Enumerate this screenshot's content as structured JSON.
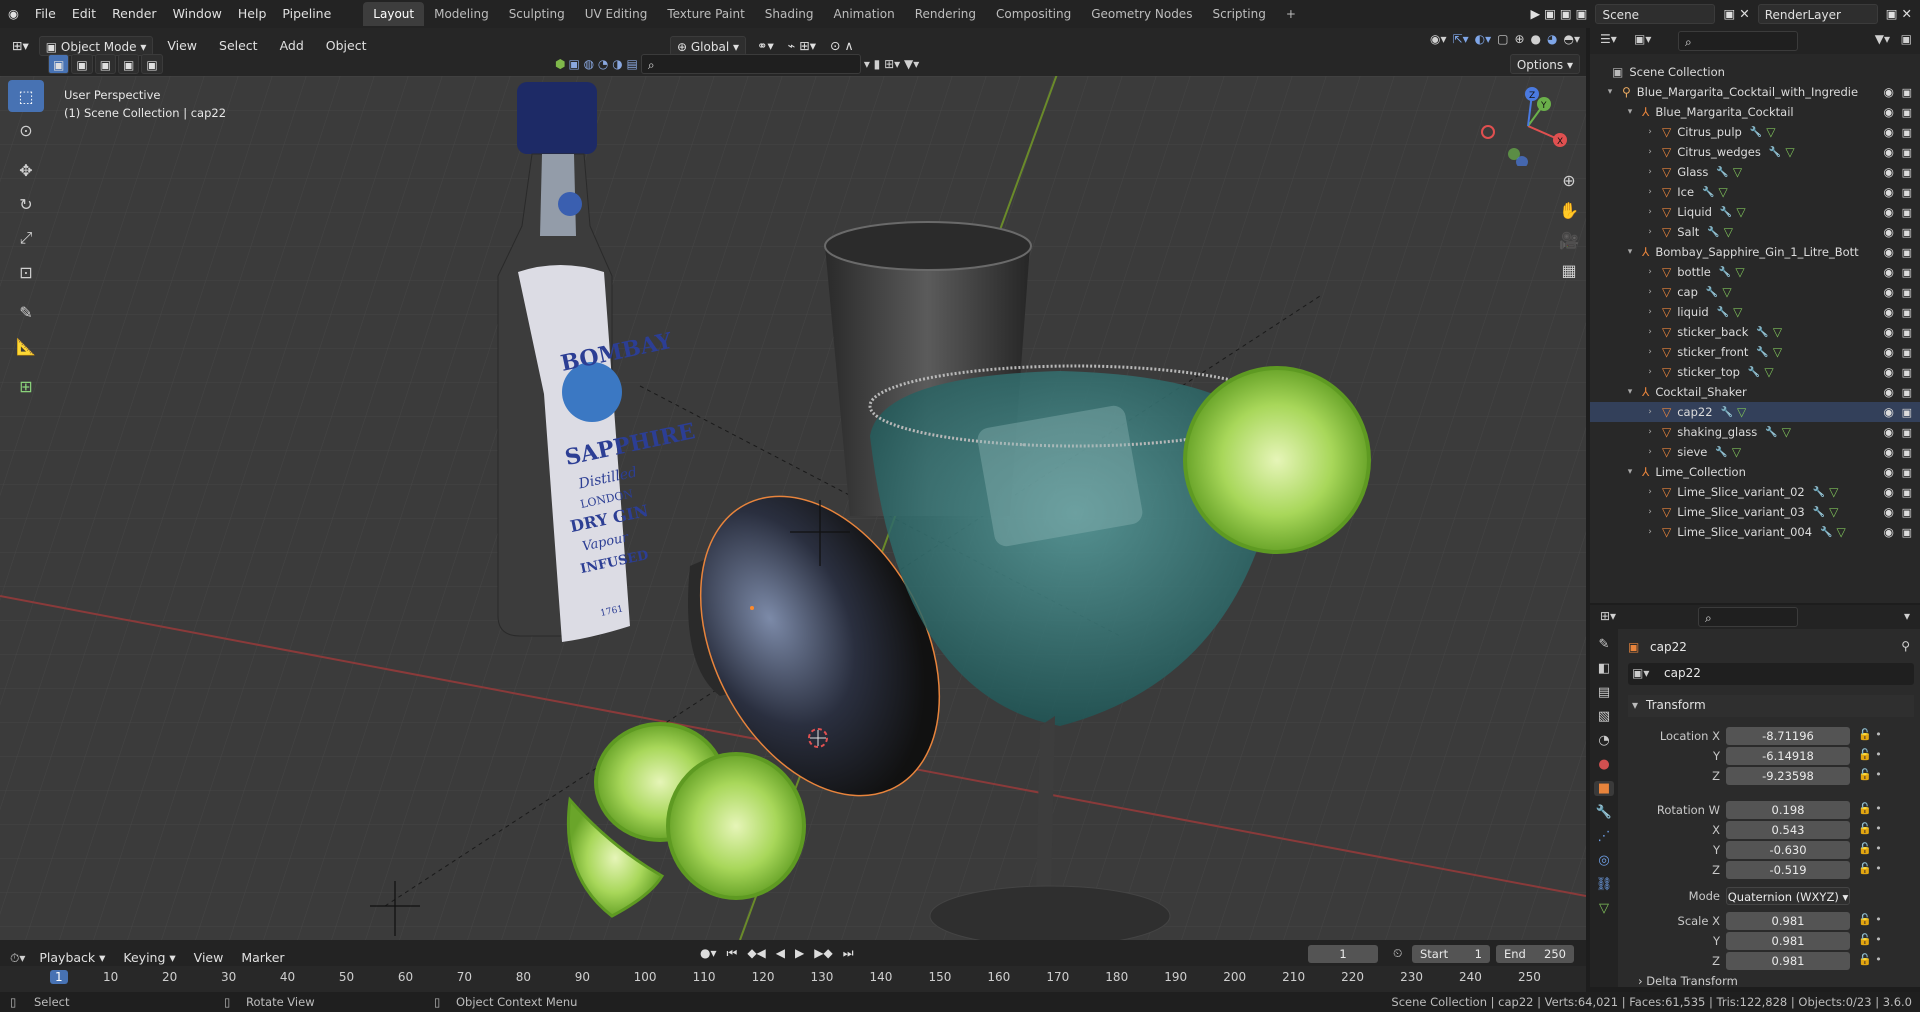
{
  "topbar": {
    "menus": [
      "File",
      "Edit",
      "Render",
      "Window",
      "Help",
      "Pipeline"
    ],
    "workspaces": [
      "Layout",
      "Modeling",
      "Sculpting",
      "UV Editing",
      "Texture Paint",
      "Shading",
      "Animation",
      "Rendering",
      "Compositing",
      "Geometry Nodes",
      "Scripting"
    ],
    "active_workspace": "Layout",
    "scene": "Scene",
    "view_layer": "RenderLayer"
  },
  "viewport_header": {
    "mode": "Object Mode",
    "menus": [
      "View",
      "Select",
      "Add",
      "Object"
    ],
    "orientation": "Global",
    "options": "Options"
  },
  "viewport": {
    "perspective": "User Perspective",
    "collection_info": "(1) Scene Collection | cap22",
    "gizmo": {
      "x": "X",
      "y": "Y",
      "z": "Z"
    },
    "label": {
      "brand1": "BOMBAY",
      "brand2": "SAPPHIRE",
      "line1": "Distilled",
      "line2": "LONDON",
      "line3": "DRY GIN",
      "line4": "Vapour",
      "line5": "INFUSED",
      "year": "1761"
    }
  },
  "outliner": {
    "root": "Scene Collection",
    "rows": [
      {
        "level": 1,
        "type": "collection",
        "name": "Blue_Margarita_Cocktail_with_Ingredie",
        "expanded": true
      },
      {
        "level": 2,
        "type": "empty",
        "name": "Blue_Margarita_Cocktail",
        "expanded": true
      },
      {
        "level": 3,
        "type": "mesh",
        "name": "Citrus_pulp"
      },
      {
        "level": 3,
        "type": "mesh",
        "name": "Citrus_wedges"
      },
      {
        "level": 3,
        "type": "mesh",
        "name": "Glass"
      },
      {
        "level": 3,
        "type": "mesh",
        "name": "Ice"
      },
      {
        "level": 3,
        "type": "mesh",
        "name": "Liquid"
      },
      {
        "level": 3,
        "type": "mesh",
        "name": "Salt"
      },
      {
        "level": 2,
        "type": "empty",
        "name": "Bombay_Sapphire_Gin_1_Litre_Bott",
        "expanded": true
      },
      {
        "level": 3,
        "type": "mesh",
        "name": "bottle"
      },
      {
        "level": 3,
        "type": "mesh",
        "name": "cap"
      },
      {
        "level": 3,
        "type": "mesh",
        "name": "liquid"
      },
      {
        "level": 3,
        "type": "mesh",
        "name": "sticker_back"
      },
      {
        "level": 3,
        "type": "mesh",
        "name": "sticker_front"
      },
      {
        "level": 3,
        "type": "mesh",
        "name": "sticker_top"
      },
      {
        "level": 2,
        "type": "empty",
        "name": "Cocktail_Shaker",
        "expanded": true
      },
      {
        "level": 3,
        "type": "mesh",
        "name": "cap22",
        "selected": true
      },
      {
        "level": 3,
        "type": "mesh",
        "name": "shaking_glass"
      },
      {
        "level": 3,
        "type": "mesh",
        "name": "sieve"
      },
      {
        "level": 2,
        "type": "empty",
        "name": "Lime_Collection",
        "expanded": true
      },
      {
        "level": 3,
        "type": "mesh",
        "name": "Lime_Slice_variant_02"
      },
      {
        "level": 3,
        "type": "mesh",
        "name": "Lime_Slice_variant_03"
      },
      {
        "level": 3,
        "type": "mesh",
        "name": "Lime_Slice_variant_004"
      }
    ]
  },
  "properties": {
    "object_name": "cap22",
    "data_name": "cap22",
    "section": "Transform",
    "location_label": "Location X",
    "location": [
      "-8.71196",
      "-6.14918",
      "-9.23598"
    ],
    "rotation_label": "Rotation W",
    "rotation": [
      "0.198",
      "0.543",
      "-0.630",
      "-0.519"
    ],
    "mode_label": "Mode",
    "mode": "Quaternion (WXYZ)",
    "scale_label": "Scale X",
    "scale": [
      "0.981",
      "0.981",
      "0.981"
    ],
    "axis": {
      "x": "X",
      "y": "Y",
      "z": "Z"
    },
    "delta": "Delta Transform"
  },
  "timeline": {
    "menus": [
      "Playback",
      "Keying",
      "View",
      "Marker"
    ],
    "current_frame": "1",
    "start_label": "Start",
    "start": "1",
    "end_label": "End",
    "end": "250",
    "ruler": [
      "1",
      "10",
      "20",
      "30",
      "40",
      "50",
      "60",
      "70",
      "80",
      "90",
      "100",
      "110",
      "120",
      "130",
      "140",
      "150",
      "160",
      "170",
      "180",
      "190",
      "200",
      "210",
      "220",
      "230",
      "240",
      "250"
    ]
  },
  "status": {
    "left1": "Select",
    "left2": "Rotate View",
    "left3": "Object Context Menu",
    "right": "Scene Collection | cap22 | Verts:64,021 | Faces:61,535 | Tris:122,828 | Objects:0/23 | 3.6.0"
  },
  "colors": {
    "accent": "#4772b3",
    "empty_orange": "#e8843c",
    "mesh_orange": "#e8843c",
    "lime": "#9bd24a"
  }
}
